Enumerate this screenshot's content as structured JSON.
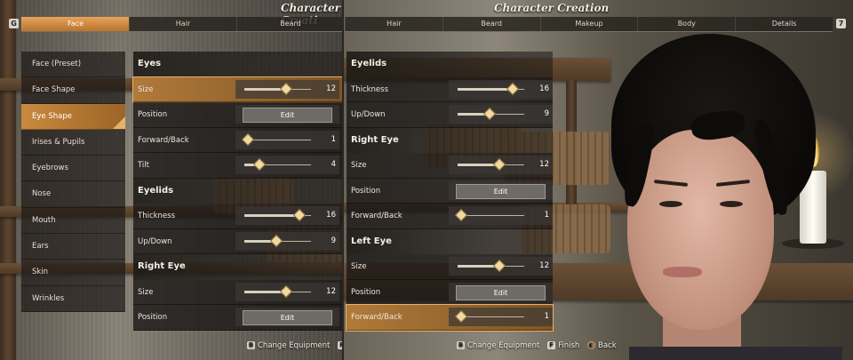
{
  "left": {
    "title": "Character Creati",
    "tab_key_left": "G",
    "tabs": [
      "Face",
      "Hair",
      "Beard"
    ],
    "active_tab": 0,
    "sidebar": [
      "Face (Preset)",
      "Face Shape",
      "Eye Shape",
      "Irises & Pupils",
      "Eyebrows",
      "Nose",
      "Mouth",
      "Ears",
      "Skin",
      "Wrinkles"
    ],
    "sidebar_active": 2,
    "sections": [
      {
        "title": "Eyes",
        "rows": [
          {
            "label": "Size",
            "type": "slider",
            "value": "12",
            "level": 0.62,
            "highlight": true
          },
          {
            "label": "Position",
            "type": "button",
            "button": "Edit"
          },
          {
            "label": "Forward/Back",
            "type": "slider",
            "value": "1",
            "level": 0.05
          },
          {
            "label": "Tilt",
            "type": "slider",
            "value": "4",
            "level": 0.22
          }
        ]
      },
      {
        "title": "Eyelids",
        "rows": [
          {
            "label": "Thickness",
            "type": "slider",
            "value": "16",
            "level": 0.82
          },
          {
            "label": "Up/Down",
            "type": "slider",
            "value": "9",
            "level": 0.48
          }
        ]
      },
      {
        "title": "Right Eye",
        "rows": [
          {
            "label": "Size",
            "type": "slider",
            "value": "12",
            "level": 0.62
          },
          {
            "label": "Position",
            "type": "button",
            "button": "Edit"
          }
        ]
      }
    ],
    "footer": {
      "k1": "B",
      "t1": "Change Equipment",
      "k2": "F",
      "t2": "Fi"
    }
  },
  "right": {
    "title": "Character Creation",
    "tab_key_right": "7",
    "tabs": [
      "Hair",
      "Beard",
      "Makeup",
      "Body",
      "Details"
    ],
    "sections": [
      {
        "title": "Eyelids",
        "rows": [
          {
            "label": "Thickness",
            "type": "slider",
            "value": "16",
            "level": 0.82
          },
          {
            "label": "Up/Down",
            "type": "slider",
            "value": "9",
            "level": 0.48
          }
        ]
      },
      {
        "title": "Right Eye",
        "rows": [
          {
            "label": "Size",
            "type": "slider",
            "value": "12",
            "level": 0.62
          },
          {
            "label": "Position",
            "type": "button",
            "button": "Edit"
          },
          {
            "label": "Forward/Back",
            "type": "slider",
            "value": "1",
            "level": 0.05
          }
        ]
      },
      {
        "title": "Left Eye",
        "rows": [
          {
            "label": "Size",
            "type": "slider",
            "value": "12",
            "level": 0.62
          },
          {
            "label": "Position",
            "type": "button",
            "button": "Edit"
          },
          {
            "label": "Forward/Back",
            "type": "slider",
            "value": "1",
            "level": 0.05,
            "highlight": true
          }
        ]
      }
    ],
    "footer": {
      "k1": "B",
      "t1": "Change Equipment",
      "k2": "F",
      "t2": "Finish",
      "k3": "◐",
      "t3": "Back"
    }
  }
}
